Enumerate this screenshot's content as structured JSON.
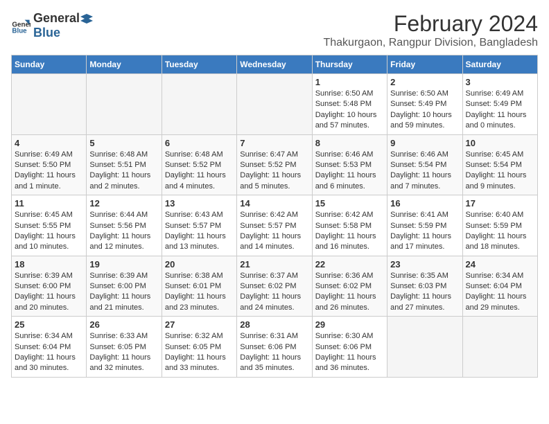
{
  "header": {
    "logo_general": "General",
    "logo_blue": "Blue",
    "month_year": "February 2024",
    "location": "Thakurgaon, Rangpur Division, Bangladesh"
  },
  "days_of_week": [
    "Sunday",
    "Monday",
    "Tuesday",
    "Wednesday",
    "Thursday",
    "Friday",
    "Saturday"
  ],
  "weeks": [
    [
      {
        "day": "",
        "info": ""
      },
      {
        "day": "",
        "info": ""
      },
      {
        "day": "",
        "info": ""
      },
      {
        "day": "",
        "info": ""
      },
      {
        "day": "1",
        "info": "Sunrise: 6:50 AM\nSunset: 5:48 PM\nDaylight: 10 hours and 57 minutes."
      },
      {
        "day": "2",
        "info": "Sunrise: 6:50 AM\nSunset: 5:49 PM\nDaylight: 10 hours and 59 minutes."
      },
      {
        "day": "3",
        "info": "Sunrise: 6:49 AM\nSunset: 5:49 PM\nDaylight: 11 hours and 0 minutes."
      }
    ],
    [
      {
        "day": "4",
        "info": "Sunrise: 6:49 AM\nSunset: 5:50 PM\nDaylight: 11 hours and 1 minute."
      },
      {
        "day": "5",
        "info": "Sunrise: 6:48 AM\nSunset: 5:51 PM\nDaylight: 11 hours and 2 minutes."
      },
      {
        "day": "6",
        "info": "Sunrise: 6:48 AM\nSunset: 5:52 PM\nDaylight: 11 hours and 4 minutes."
      },
      {
        "day": "7",
        "info": "Sunrise: 6:47 AM\nSunset: 5:52 PM\nDaylight: 11 hours and 5 minutes."
      },
      {
        "day": "8",
        "info": "Sunrise: 6:46 AM\nSunset: 5:53 PM\nDaylight: 11 hours and 6 minutes."
      },
      {
        "day": "9",
        "info": "Sunrise: 6:46 AM\nSunset: 5:54 PM\nDaylight: 11 hours and 7 minutes."
      },
      {
        "day": "10",
        "info": "Sunrise: 6:45 AM\nSunset: 5:54 PM\nDaylight: 11 hours and 9 minutes."
      }
    ],
    [
      {
        "day": "11",
        "info": "Sunrise: 6:45 AM\nSunset: 5:55 PM\nDaylight: 11 hours and 10 minutes."
      },
      {
        "day": "12",
        "info": "Sunrise: 6:44 AM\nSunset: 5:56 PM\nDaylight: 11 hours and 12 minutes."
      },
      {
        "day": "13",
        "info": "Sunrise: 6:43 AM\nSunset: 5:57 PM\nDaylight: 11 hours and 13 minutes."
      },
      {
        "day": "14",
        "info": "Sunrise: 6:42 AM\nSunset: 5:57 PM\nDaylight: 11 hours and 14 minutes."
      },
      {
        "day": "15",
        "info": "Sunrise: 6:42 AM\nSunset: 5:58 PM\nDaylight: 11 hours and 16 minutes."
      },
      {
        "day": "16",
        "info": "Sunrise: 6:41 AM\nSunset: 5:59 PM\nDaylight: 11 hours and 17 minutes."
      },
      {
        "day": "17",
        "info": "Sunrise: 6:40 AM\nSunset: 5:59 PM\nDaylight: 11 hours and 18 minutes."
      }
    ],
    [
      {
        "day": "18",
        "info": "Sunrise: 6:39 AM\nSunset: 6:00 PM\nDaylight: 11 hours and 20 minutes."
      },
      {
        "day": "19",
        "info": "Sunrise: 6:39 AM\nSunset: 6:00 PM\nDaylight: 11 hours and 21 minutes."
      },
      {
        "day": "20",
        "info": "Sunrise: 6:38 AM\nSunset: 6:01 PM\nDaylight: 11 hours and 23 minutes."
      },
      {
        "day": "21",
        "info": "Sunrise: 6:37 AM\nSunset: 6:02 PM\nDaylight: 11 hours and 24 minutes."
      },
      {
        "day": "22",
        "info": "Sunrise: 6:36 AM\nSunset: 6:02 PM\nDaylight: 11 hours and 26 minutes."
      },
      {
        "day": "23",
        "info": "Sunrise: 6:35 AM\nSunset: 6:03 PM\nDaylight: 11 hours and 27 minutes."
      },
      {
        "day": "24",
        "info": "Sunrise: 6:34 AM\nSunset: 6:04 PM\nDaylight: 11 hours and 29 minutes."
      }
    ],
    [
      {
        "day": "25",
        "info": "Sunrise: 6:34 AM\nSunset: 6:04 PM\nDaylight: 11 hours and 30 minutes."
      },
      {
        "day": "26",
        "info": "Sunrise: 6:33 AM\nSunset: 6:05 PM\nDaylight: 11 hours and 32 minutes."
      },
      {
        "day": "27",
        "info": "Sunrise: 6:32 AM\nSunset: 6:05 PM\nDaylight: 11 hours and 33 minutes."
      },
      {
        "day": "28",
        "info": "Sunrise: 6:31 AM\nSunset: 6:06 PM\nDaylight: 11 hours and 35 minutes."
      },
      {
        "day": "29",
        "info": "Sunrise: 6:30 AM\nSunset: 6:06 PM\nDaylight: 11 hours and 36 minutes."
      },
      {
        "day": "",
        "info": ""
      },
      {
        "day": "",
        "info": ""
      }
    ]
  ]
}
